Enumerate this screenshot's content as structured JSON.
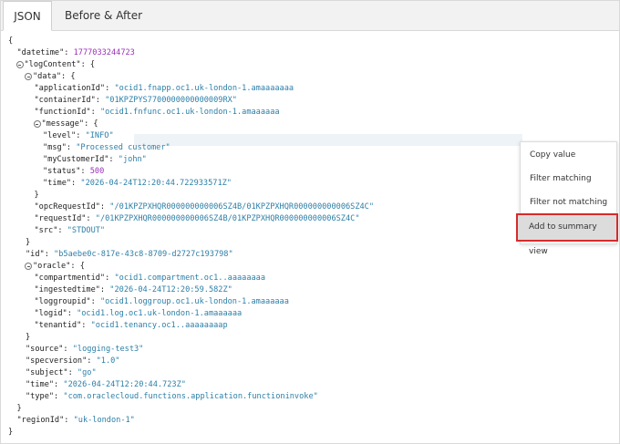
{
  "tabs": [
    "JSON",
    "Before & After"
  ],
  "context_menu": {
    "items": [
      "Copy value",
      "Filter matching",
      "Filter not matching"
    ],
    "selected": "Add to summary view"
  },
  "json_lines": [
    {
      "i": 0,
      "toggle": false,
      "segs": [
        {
          "t": "{",
          "c": "p"
        }
      ]
    },
    {
      "i": 1,
      "toggle": false,
      "segs": [
        {
          "t": "\"datetime\": ",
          "c": "k"
        },
        {
          "t": "1777033244723",
          "c": "n"
        }
      ]
    },
    {
      "i": 1,
      "toggle": true,
      "segs": [
        {
          "t": "\"logContent\": {",
          "c": "k"
        }
      ]
    },
    {
      "i": 2,
      "toggle": true,
      "segs": [
        {
          "t": "\"data\": {",
          "c": "k"
        }
      ]
    },
    {
      "i": 3,
      "toggle": false,
      "segs": [
        {
          "t": "\"applicationId\": ",
          "c": "k"
        },
        {
          "t": "\"ocid1.fnapp.oc1.uk-london-1.amaaaaaaa",
          "c": "s"
        }
      ]
    },
    {
      "i": 3,
      "toggle": false,
      "segs": [
        {
          "t": "\"containerId\": ",
          "c": "k"
        },
        {
          "t": "\"01KPZPYS7700000000000009RX\"",
          "c": "s"
        }
      ]
    },
    {
      "i": 3,
      "toggle": false,
      "segs": [
        {
          "t": "\"functionId\": ",
          "c": "k"
        },
        {
          "t": "\"ocid1.fnfunc.oc1.uk-london-1.amaaaaaa",
          "c": "s"
        }
      ]
    },
    {
      "i": 3,
      "toggle": true,
      "segs": [
        {
          "t": "\"message\": {",
          "c": "k"
        }
      ]
    },
    {
      "i": 4,
      "toggle": false,
      "segs": [
        {
          "t": "\"level\": ",
          "c": "k"
        },
        {
          "t": "\"INFO\"",
          "c": "s"
        }
      ]
    },
    {
      "i": 4,
      "toggle": false,
      "segs": [
        {
          "t": "\"msg\": ",
          "c": "k"
        },
        {
          "t": "\"Processed customer\"",
          "c": "s"
        }
      ]
    },
    {
      "i": 4,
      "toggle": false,
      "segs": [
        {
          "t": "\"myCustomerId\": ",
          "c": "k"
        },
        {
          "t": "\"john\"",
          "c": "s"
        }
      ]
    },
    {
      "i": 4,
      "toggle": false,
      "segs": [
        {
          "t": "\"status\": ",
          "c": "k"
        },
        {
          "t": "500",
          "c": "n"
        }
      ]
    },
    {
      "i": 4,
      "toggle": false,
      "segs": [
        {
          "t": "\"time\": ",
          "c": "k"
        },
        {
          "t": "\"2026-04-24T12:20:44.722933571Z\"",
          "c": "s"
        }
      ]
    },
    {
      "i": 3,
      "toggle": false,
      "segs": [
        {
          "t": "}",
          "c": "p"
        }
      ]
    },
    {
      "i": 3,
      "toggle": false,
      "segs": [
        {
          "t": "\"opcRequestId\": ",
          "c": "k"
        },
        {
          "t": "\"/01KPZPXHQR000000000006SZ4B/01KPZPXHQR000000000006SZ4C\"",
          "c": "s"
        }
      ]
    },
    {
      "i": 3,
      "toggle": false,
      "segs": [
        {
          "t": "\"requestId\": ",
          "c": "k"
        },
        {
          "t": "\"/01KPZPXHQR000000000006SZ4B/01KPZPXHQR000000000006SZ4C\"",
          "c": "s"
        }
      ]
    },
    {
      "i": 3,
      "toggle": false,
      "segs": [
        {
          "t": "\"src\": ",
          "c": "k"
        },
        {
          "t": "\"STDOUT\"",
          "c": "s"
        }
      ]
    },
    {
      "i": 2,
      "toggle": false,
      "segs": [
        {
          "t": "}",
          "c": "p"
        }
      ]
    },
    {
      "i": 2,
      "toggle": false,
      "segs": [
        {
          "t": "\"id\": ",
          "c": "k"
        },
        {
          "t": "\"b5aebe0c-817e-43c8-8709-d2727c193798\"",
          "c": "s"
        }
      ]
    },
    {
      "i": 2,
      "toggle": true,
      "segs": [
        {
          "t": "\"oracle\": {",
          "c": "k"
        }
      ]
    },
    {
      "i": 3,
      "toggle": false,
      "segs": [
        {
          "t": "\"compartmentid\": ",
          "c": "k"
        },
        {
          "t": "\"ocid1.compartment.oc1..aaaaaaaa",
          "c": "s"
        }
      ]
    },
    {
      "i": 3,
      "toggle": false,
      "segs": [
        {
          "t": "\"ingestedtime\": ",
          "c": "k"
        },
        {
          "t": "\"2026-04-24T12:20:59.582Z\"",
          "c": "s"
        }
      ]
    },
    {
      "i": 3,
      "toggle": false,
      "segs": [
        {
          "t": "\"loggroupid\": ",
          "c": "k"
        },
        {
          "t": "\"ocid1.loggroup.oc1.uk-london-1.amaaaaaa",
          "c": "s"
        }
      ]
    },
    {
      "i": 3,
      "toggle": false,
      "segs": [
        {
          "t": "\"logid\": ",
          "c": "k"
        },
        {
          "t": "\"ocid1.log.oc1.uk-london-1.amaaaaaa",
          "c": "s"
        }
      ]
    },
    {
      "i": 3,
      "toggle": false,
      "segs": [
        {
          "t": "\"tenantid\": ",
          "c": "k"
        },
        {
          "t": "\"ocid1.tenancy.oc1..aaaaaaaap",
          "c": "s"
        }
      ]
    },
    {
      "i": 2,
      "toggle": false,
      "segs": [
        {
          "t": "}",
          "c": "p"
        }
      ]
    },
    {
      "i": 2,
      "toggle": false,
      "segs": [
        {
          "t": "\"source\": ",
          "c": "k"
        },
        {
          "t": "\"logging-test3\"",
          "c": "s"
        }
      ]
    },
    {
      "i": 2,
      "toggle": false,
      "segs": [
        {
          "t": "\"specversion\": ",
          "c": "k"
        },
        {
          "t": "\"1.0\"",
          "c": "s"
        }
      ]
    },
    {
      "i": 2,
      "toggle": false,
      "segs": [
        {
          "t": "\"subject\": ",
          "c": "k"
        },
        {
          "t": "\"go\"",
          "c": "s"
        }
      ]
    },
    {
      "i": 2,
      "toggle": false,
      "segs": [
        {
          "t": "\"time\": ",
          "c": "k"
        },
        {
          "t": "\"2026-04-24T12:20:44.723Z\"",
          "c": "s"
        }
      ]
    },
    {
      "i": 2,
      "toggle": false,
      "segs": [
        {
          "t": "\"type\": ",
          "c": "k"
        },
        {
          "t": "\"com.oraclecloud.functions.application.functioninvoke\"",
          "c": "s"
        }
      ]
    },
    {
      "i": 1,
      "toggle": false,
      "segs": [
        {
          "t": "}",
          "c": "p"
        }
      ]
    },
    {
      "i": 1,
      "toggle": false,
      "segs": [
        {
          "t": "\"regionId\": ",
          "c": "k"
        },
        {
          "t": "\"uk-london-1\"",
          "c": "s"
        }
      ]
    },
    {
      "i": 0,
      "toggle": false,
      "segs": [
        {
          "t": "}",
          "c": "p"
        }
      ]
    }
  ]
}
